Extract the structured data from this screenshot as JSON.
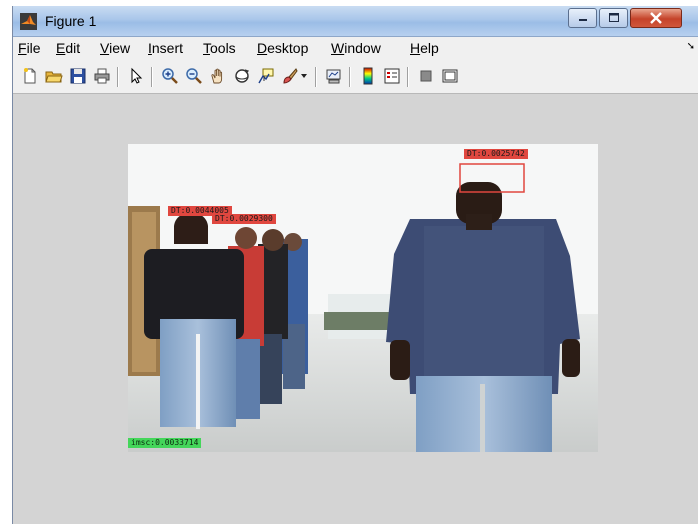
{
  "window": {
    "title": "Figure 1"
  },
  "menu": {
    "items": [
      "File",
      "Edit",
      "View",
      "Insert",
      "Tools",
      "Desktop",
      "Window",
      "Help"
    ]
  },
  "toolbar": {
    "icons": [
      "new-figure-icon",
      "open-file-icon",
      "save-icon",
      "print-icon",
      "edit-plot-arrow-icon",
      "zoom-in-icon",
      "zoom-out-icon",
      "pan-hand-icon",
      "rotate-3d-icon",
      "data-cursor-icon",
      "brush-icon",
      "brush-dropdown-icon",
      "link-plot-icon",
      "colorbar-icon",
      "legend-icon",
      "hide-plot-tools-icon",
      "show-plot-tools-icon"
    ]
  },
  "detections": [
    {
      "label": "DT:0.0025742",
      "color": "#e0473f"
    },
    {
      "label": "DT:0.0044005",
      "color": "#e0473f"
    },
    {
      "label": "DT:0.0029300",
      "color": "#e0473f"
    },
    {
      "label": "imsc:0.0033714",
      "color": "#44d65a"
    }
  ],
  "colors": {
    "window_bg": "#d4d4d4",
    "titlebar": "#a9c6ea",
    "close_button": "#c5432a"
  }
}
